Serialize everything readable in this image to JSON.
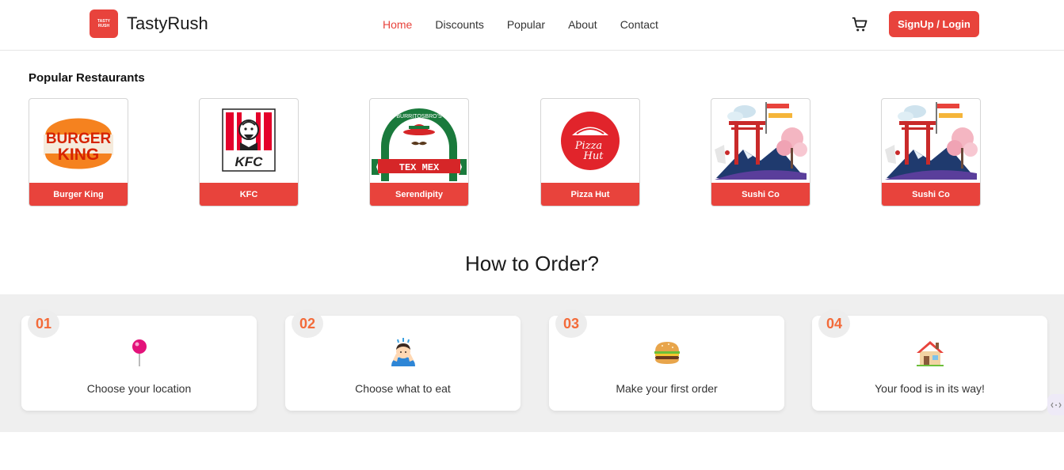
{
  "brand": {
    "logo_line1": "TASTY",
    "logo_line2": "RUSH",
    "name": "TastyRush"
  },
  "nav": {
    "links": [
      "Home",
      "Discounts",
      "Popular",
      "About",
      "Contact"
    ],
    "active": "Home",
    "signup_label": "SignUp / Login"
  },
  "popular": {
    "title": "Popular Restaurants",
    "restaurants": [
      {
        "name": "Burger King",
        "logo": "burger-king-logo",
        "logo_text": [
          "BURGER",
          "KING"
        ]
      },
      {
        "name": "KFC",
        "logo": "kfc-logo",
        "logo_text": [
          "KFC"
        ]
      },
      {
        "name": "Serendipity",
        "logo": "tex-mex-logo",
        "logo_text": [
          "BURRITOSBRO'S",
          "TEX MEX"
        ]
      },
      {
        "name": "Pizza Hut",
        "logo": "pizza-hut-logo",
        "logo_text": [
          "Pizza",
          "Hut"
        ]
      },
      {
        "name": "Sushi Co",
        "logo": "torii-gate-illustration"
      },
      {
        "name": "Sushi Co",
        "logo": "torii-gate-illustration"
      }
    ]
  },
  "how_to_order": {
    "title": "How to Order?",
    "steps": [
      {
        "number": "01",
        "text": "Choose your location",
        "icon": "pin-icon"
      },
      {
        "number": "02",
        "text": "Choose what to eat",
        "icon": "thinking-person-icon"
      },
      {
        "number": "03",
        "text": "Make your first order",
        "icon": "burger-icon"
      },
      {
        "number": "04",
        "text": "Your food is in its way!",
        "icon": "house-icon"
      }
    ]
  },
  "colors": {
    "accent": "#e8433c",
    "step_number": "#f36b3a",
    "steps_background": "#efefef"
  }
}
